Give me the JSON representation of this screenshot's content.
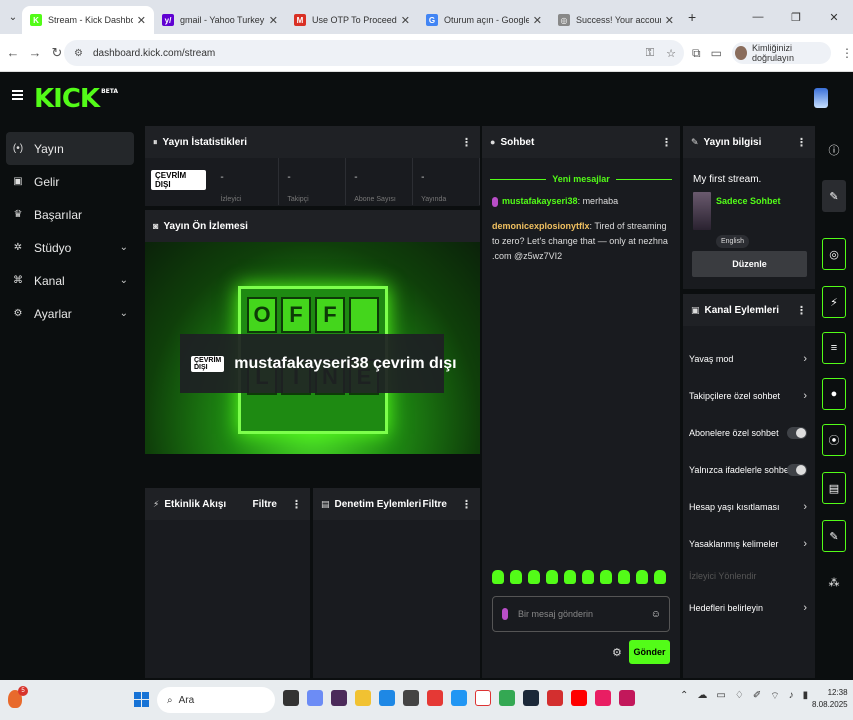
{
  "browser": {
    "tabs": [
      {
        "title": "Stream - Kick Dashboard",
        "active": true,
        "favicon": "kick-icon",
        "favicon_color": "#53fc18",
        "favicon_letter": "K"
      },
      {
        "title": "gmail - Yahoo Turkey Arama Sonuçları",
        "active": false,
        "favicon": "yahoo-icon",
        "favicon_color": "#6001d2",
        "favicon_letter": "y/"
      },
      {
        "title": "Use OTP To Proceed - mustiyakamust",
        "active": false,
        "favicon": "gmail-icon",
        "favicon_color": "#d93025",
        "favicon_letter": "M"
      },
      {
        "title": "Oturum açın - Google Hesapları",
        "active": false,
        "favicon": "google-icon",
        "favicon_color": "#4285f4",
        "favicon_letter": "G"
      },
      {
        "title": "Success! Your account is connected",
        "active": false,
        "favicon": "globe-icon",
        "favicon_color": "#888888",
        "favicon_letter": "◎"
      }
    ],
    "url": "dashboard.kick.com/stream",
    "verify_label": "Kimliğinizi doğrulayın"
  },
  "app": {
    "brand": "KICK",
    "brand_badge": "BETA",
    "accent": "#53fc18"
  },
  "sidebar": {
    "items": [
      {
        "label": "Yayın",
        "icon": "broadcast-icon",
        "active": true,
        "expandable": false
      },
      {
        "label": "Gelir",
        "icon": "revenue-icon",
        "active": false,
        "expandable": false
      },
      {
        "label": "Başarılar",
        "icon": "trophy-icon",
        "active": false,
        "expandable": false
      },
      {
        "label": "Stüdyo",
        "icon": "studio-icon",
        "active": false,
        "expandable": true
      },
      {
        "label": "Kanal",
        "icon": "channel-icon",
        "active": false,
        "expandable": true
      },
      {
        "label": "Ayarlar",
        "icon": "settings-icon",
        "active": false,
        "expandable": true
      }
    ]
  },
  "stats": {
    "title": "Yayın İstatistikleri",
    "status_badge": "ÇEVRİM DIŞI",
    "items": [
      {
        "value": "-",
        "label": "İzleyici"
      },
      {
        "value": "-",
        "label": "Takipçi"
      },
      {
        "value": "-",
        "label": "Abone Sayısı"
      },
      {
        "value": "-",
        "label": "Yayında"
      }
    ]
  },
  "preview": {
    "title": "Yayın Ön İzlemesi",
    "badge": "ÇEVRİM DIŞI",
    "message": "mustafakayseri38 çevrim dışı",
    "sign_top": [
      "O",
      "F",
      "F",
      ""
    ],
    "sign_bottom": [
      "L",
      "I",
      "N",
      "E"
    ]
  },
  "events": {
    "title": "Etkinlik Akışı",
    "filter": "Filtre"
  },
  "moderation": {
    "title": "Denetim Eylemleri",
    "filter": "Filtre"
  },
  "chat": {
    "title": "Sohbet",
    "new_messages": "Yeni mesajlar",
    "messages": [
      {
        "user": "mustafakayseri38",
        "user_color": "#53fc18",
        "text": ": merhaba"
      },
      {
        "user": "demonicexplosionytflx",
        "user_color": "#f0c060",
        "text": ": Tired of streaming to zero? Let's change that — only at nezhna .com @z5wz7VI2"
      }
    ],
    "input_placeholder": "Bir mesaj gönderin",
    "send_label": "Gönder"
  },
  "stream_info": {
    "title": "Yayın bilgisi",
    "stream_title": "My first stream.",
    "category": "Sadece Sohbet",
    "language": "English",
    "edit_label": "Düzenle"
  },
  "channel_actions": {
    "title": "Kanal Eylemleri",
    "items": [
      {
        "label": "Yavaş mod",
        "type": "chevron"
      },
      {
        "label": "Takipçilere özel sohbet",
        "type": "chevron"
      },
      {
        "label": "Abonelere özel sohbet",
        "type": "toggle"
      },
      {
        "label": "Yalnızca ifadelerle sohbet",
        "type": "toggle"
      },
      {
        "label": "Hesap yaşı kısıtlaması",
        "type": "chevron"
      },
      {
        "label": "Yasaklanmış kelimeler",
        "type": "chevron"
      },
      {
        "label": "İzleyici Yönlendir",
        "type": "disabled"
      },
      {
        "label": "Hedefleri belirleyin",
        "type": "chevron"
      }
    ]
  },
  "taskbar": {
    "notification_count": "5",
    "search_label": "Ara",
    "time": "12:38",
    "date": "8.08.2025"
  }
}
